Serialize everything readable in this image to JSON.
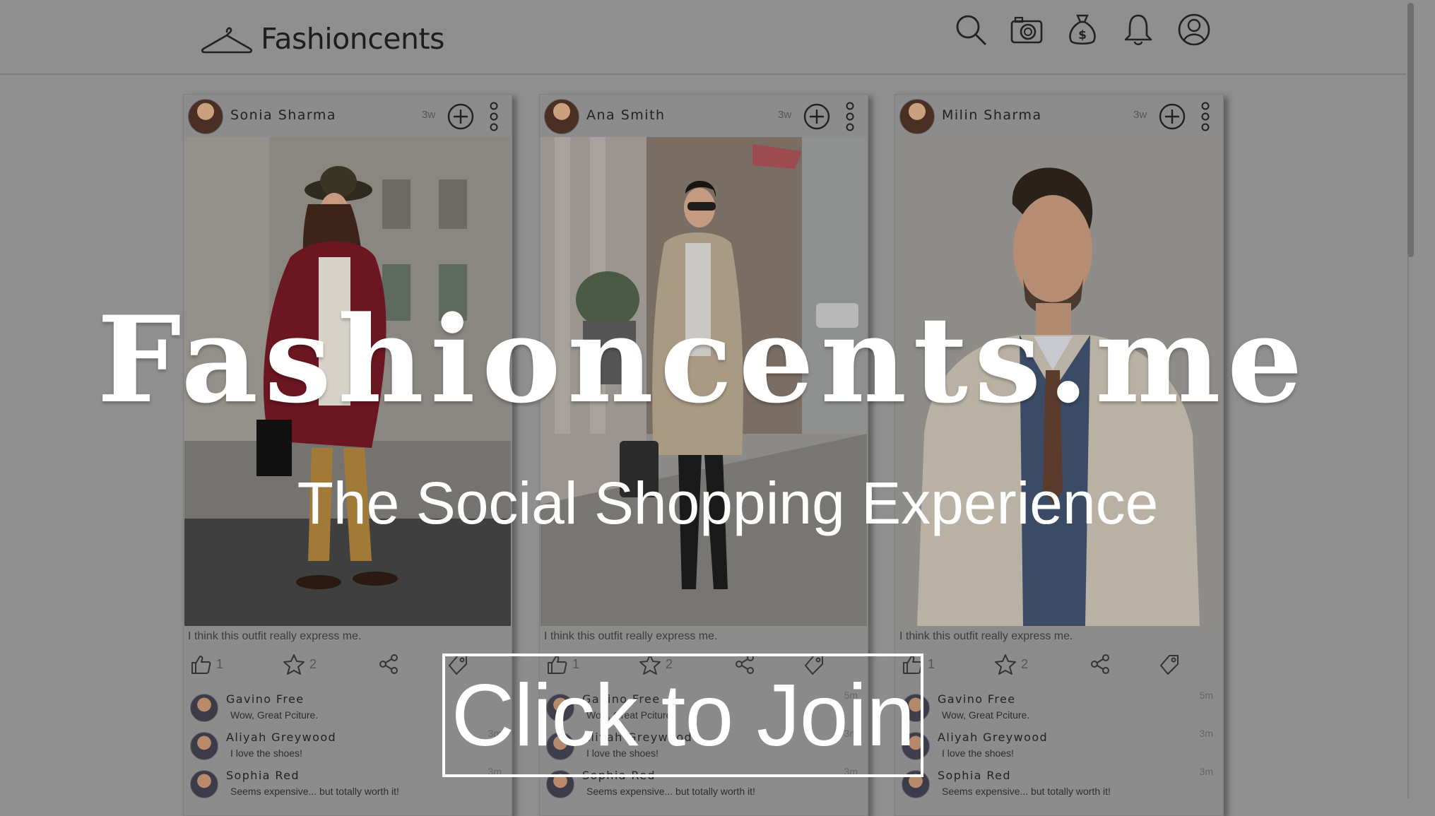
{
  "app": {
    "name": "Fashioncents"
  },
  "header": {
    "icons": [
      "search-icon",
      "camera-icon",
      "money-bag-icon",
      "bell-icon",
      "user-icon"
    ]
  },
  "hero": {
    "title": "Fashioncents.me",
    "subtitle": "The Social Shopping Experience",
    "cta_label": "Click to Join"
  },
  "cards": [
    {
      "name": "Sonia Sharma",
      "time": "3w",
      "caption": "I think this outfit really express me.",
      "likes": "1",
      "stars": "2",
      "comments": [
        {
          "name": "Gavino Free",
          "text": "Wow, Great Pciture.",
          "time": ""
        },
        {
          "name": "Aliyah Greywood",
          "text": "I love the shoes!",
          "time": "3m"
        },
        {
          "name": "Sophia Red",
          "text": "Seems expensive... but totally worth it!",
          "time": "3m"
        }
      ]
    },
    {
      "name": "Ana Smith",
      "time": "3w",
      "caption": "I think this outfit really express me.",
      "likes": "1",
      "stars": "2",
      "comments": [
        {
          "name": "Gavino Free",
          "text": "Wow, Great Pciture.",
          "time": "5m"
        },
        {
          "name": "Aliyah Greywood",
          "text": "I love the shoes!",
          "time": "3m"
        },
        {
          "name": "Sophia Red",
          "text": "Seems expensive... but totally worth it!",
          "time": "3m"
        }
      ]
    },
    {
      "name": "Milin Sharma",
      "time": "3w",
      "caption": "I think this outfit really express me.",
      "likes": "1",
      "stars": "2",
      "comments": [
        {
          "name": "Gavino Free",
          "text": "Wow, Great Pciture.",
          "time": "5m"
        },
        {
          "name": "Aliyah Greywood",
          "text": "I love the shoes!",
          "time": "3m"
        },
        {
          "name": "Sophia Red",
          "text": "Seems expensive... but totally worth it!",
          "time": "3m"
        }
      ]
    }
  ]
}
